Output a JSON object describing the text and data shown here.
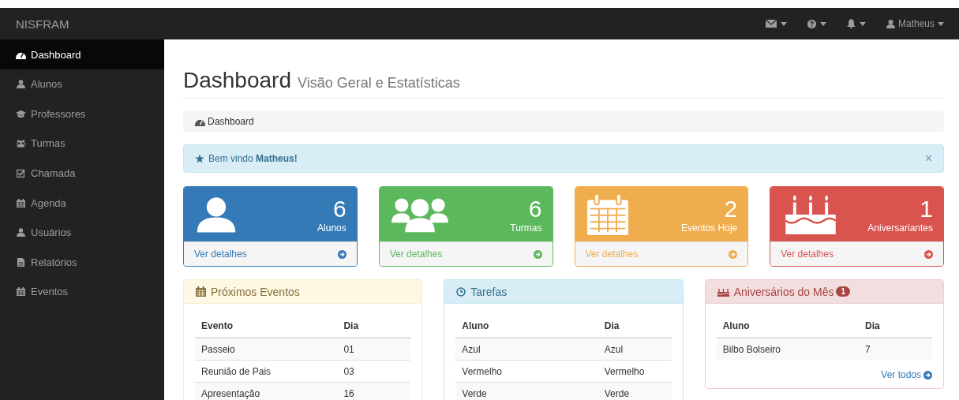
{
  "navbar": {
    "brand": "NISFRAM",
    "user": "Matheus"
  },
  "sidebar": {
    "items": [
      {
        "label": "Dashboard",
        "selected": true
      },
      {
        "label": "Alunos",
        "selected": false
      },
      {
        "label": "Professores",
        "selected": false
      },
      {
        "label": "Turmas",
        "selected": false
      },
      {
        "label": "Chamada",
        "selected": false
      },
      {
        "label": "Agenda",
        "selected": false
      },
      {
        "label": "Usuários",
        "selected": false
      },
      {
        "label": "Relatórios",
        "selected": false
      },
      {
        "label": "Eventos",
        "selected": false
      }
    ]
  },
  "page_header": {
    "title": "Dashboard",
    "subtitle": "Visão Geral e Estatísticas"
  },
  "breadcrumb": "Dashboard",
  "alert": {
    "text": "Bem vindo **Matheus!**",
    "close": "×"
  },
  "stat_cards": [
    {
      "kind": "primary",
      "count": "6",
      "label": "Alunos",
      "link": "Ver detalhes"
    },
    {
      "kind": "success",
      "count": "6",
      "label": "Turmas",
      "link": "Ver detalhes"
    },
    {
      "kind": "warning",
      "count": "2",
      "label": "Eventos Hoje",
      "link": "Ver detalhes"
    },
    {
      "kind": "danger",
      "count": "1",
      "label": "Aniversariantes",
      "link": "Ver detalhes"
    }
  ],
  "panels": [
    {
      "kind": "warning",
      "title": "Próximos Eventos",
      "columns": [
        "Evento",
        "Dia"
      ],
      "rows": [
        [
          "Passeio",
          "01"
        ],
        [
          "Reunião de Pais",
          "03"
        ],
        [
          "Apresentação",
          "16"
        ]
      ]
    },
    {
      "kind": "info",
      "title": "Tarefas",
      "columns": [
        "Aluno",
        "Dia"
      ],
      "rows": [
        [
          "Azul",
          "Azul"
        ],
        [
          "Vermelho",
          "Vermelho"
        ],
        [
          "Verde",
          "Verde"
        ]
      ]
    },
    {
      "kind": "danger",
      "title": "Aniversários do Mês",
      "badge": "1",
      "columns": [
        "Aluno",
        "Dia"
      ],
      "rows": [
        [
          "Bilbo Bolseiro",
          "7"
        ]
      ],
      "footer_link": "Ver todos"
    }
  ]
}
